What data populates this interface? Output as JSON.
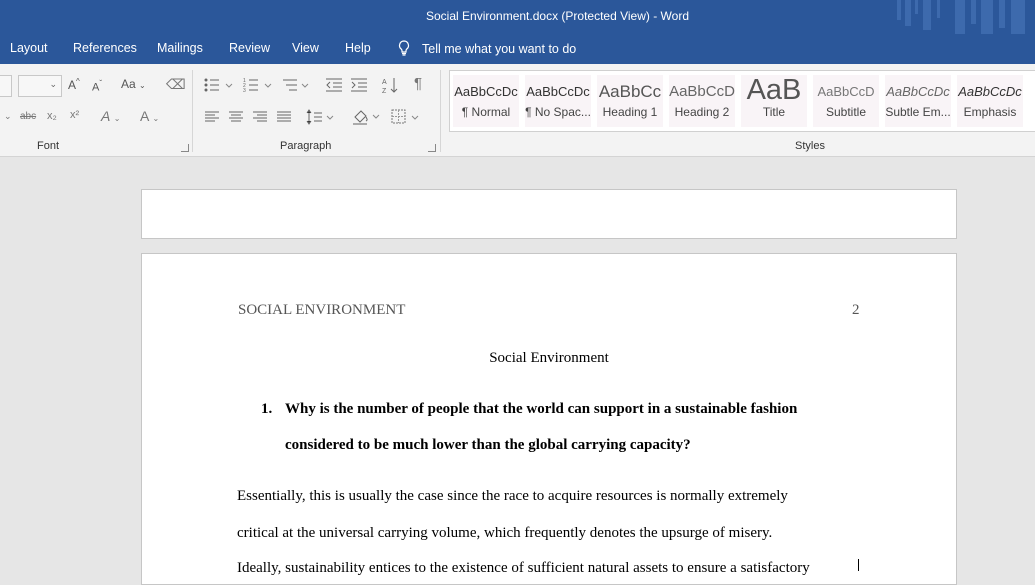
{
  "window": {
    "title": "Social Environment.docx (Protected View)  -  Word"
  },
  "tabs": [
    "Layout",
    "References",
    "Mailings",
    "Review",
    "View",
    "Help"
  ],
  "tell_me": {
    "placeholder": "Tell me what you want to do",
    "icon": "lightbulb-icon"
  },
  "ribbon": {
    "groups": {
      "font": "Font",
      "paragraph": "Paragraph",
      "styles": "Styles"
    },
    "font_buttons": {
      "grow": "A",
      "shrink": "A",
      "change_case": "Aa",
      "strikethrough": "abc",
      "subscript": "x₂",
      "superscript": "x²",
      "text_effects": "A",
      "font_color": "A"
    },
    "styles_gallery": [
      {
        "preview": "AaBbCcDc",
        "name": "¶ Normal"
      },
      {
        "preview": "AaBbCcDc",
        "name": "¶ No Spac..."
      },
      {
        "preview": "AaBbCc",
        "name": "Heading 1"
      },
      {
        "preview": "AaBbCcD",
        "name": "Heading 2"
      },
      {
        "preview": "AaB",
        "name": "Title"
      },
      {
        "preview": "AaBbCcD",
        "name": "Subtitle"
      },
      {
        "preview": "AaBbCcDc",
        "name": "Subtle Em..."
      },
      {
        "preview": "AaBbCcDc",
        "name": "Emphasis"
      }
    ]
  },
  "document": {
    "running_head": "SOCIAL ENVIRONMENT",
    "page_number": "2",
    "title": "Social Environment",
    "question_number": "1.",
    "question_line1": "Why is the number of people that the world can support in a sustainable fashion",
    "question_line2": "considered to be much lower than the global carrying capacity?",
    "para_line1": "Essentially, this is usually the case since the race to acquire resources is normally extremely",
    "para_line2": "critical at the universal carrying volume, which frequently denotes the upsurge of misery.",
    "para_line3": "Ideally, sustainability entices to the existence of sufficient natural assets to ensure a satisfactory"
  }
}
